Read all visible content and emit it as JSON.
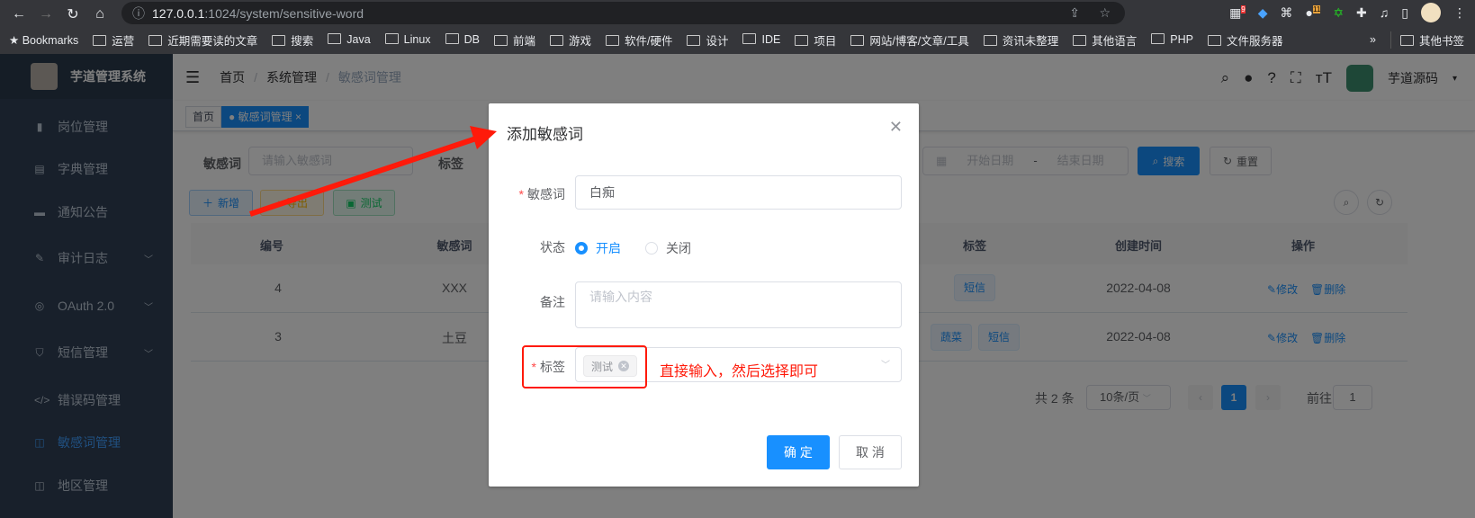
{
  "browser": {
    "url_host": "127.0.0.1",
    "url_rest": ":1024/system/sensitive-word",
    "bookmarks": [
      "Bookmarks",
      "运营",
      "近期需要读的文章",
      "搜索",
      "Java",
      "Linux",
      "DB",
      "前端",
      "游戏",
      "软件/硬件",
      "设计",
      "IDE",
      "项目",
      "网站/博客/文章/工具",
      "资讯未整理",
      "其他语言",
      "PHP",
      "文件服务器"
    ],
    "more": "»",
    "other_bookmarks": "其他书签",
    "ext_badges": [
      "9",
      "11"
    ]
  },
  "app": {
    "title": "芋道管理系统",
    "user": "芋道源码",
    "sidebar": [
      {
        "label": "岗位管理",
        "icon": "post-icon"
      },
      {
        "label": "字典管理",
        "icon": "dict-icon"
      },
      {
        "label": "通知公告",
        "icon": "message-icon"
      },
      {
        "label": "审计日志",
        "icon": "log-icon",
        "chevron": true
      },
      {
        "label": "OAuth 2.0",
        "icon": "oauth-icon",
        "chevron": true
      },
      {
        "label": "短信管理",
        "icon": "shield-icon",
        "chevron": true
      },
      {
        "label": "错误码管理",
        "icon": "code-icon"
      },
      {
        "label": "敏感词管理",
        "icon": "book-icon",
        "active": true
      },
      {
        "label": "地区管理",
        "icon": "map-icon"
      }
    ],
    "breadcrumb": [
      "首页",
      "系统管理",
      "敏感词管理"
    ],
    "tags_view": [
      "首页",
      "敏感词管理"
    ],
    "search": {
      "word_label": "敏感词",
      "word_placeholder": "请输入敏感词",
      "tag_label": "标签",
      "date_start": "开始日期",
      "date_sep": "-",
      "date_end": "结束日期",
      "search_btn": "搜索",
      "reset_btn": "重置"
    },
    "toolbar": {
      "add": "新增",
      "export": "导出",
      "test": "测试"
    },
    "table": {
      "headers": [
        "编号",
        "敏感词",
        "标签",
        "创建时间",
        "操作"
      ],
      "rows": [
        {
          "id": "4",
          "word": "XXX",
          "tags": [
            "短信"
          ],
          "created": "2022-04-08"
        },
        {
          "id": "3",
          "word": "土豆",
          "tags": [
            "蔬菜",
            "短信"
          ],
          "created": "2022-04-08"
        }
      ],
      "edit": "修改",
      "delete": "删除"
    },
    "pagination": {
      "total": "共 2 条",
      "page_size": "10条/页",
      "current": "1",
      "goto": "前往",
      "goto_value": "1"
    }
  },
  "dialog": {
    "title": "添加敏感词",
    "word_label": "敏感词",
    "word_value": "白痴",
    "status_label": "状态",
    "status_options": [
      "开启",
      "关闭"
    ],
    "status_selected": "开启",
    "remark_label": "备注",
    "remark_placeholder": "请输入内容",
    "tags_label": "标签",
    "tags_value": [
      "测试"
    ],
    "confirm": "确 定",
    "cancel": "取 消"
  },
  "annotation": {
    "text": "直接输入，然后选择即可",
    "color": "#ff1a0a"
  }
}
